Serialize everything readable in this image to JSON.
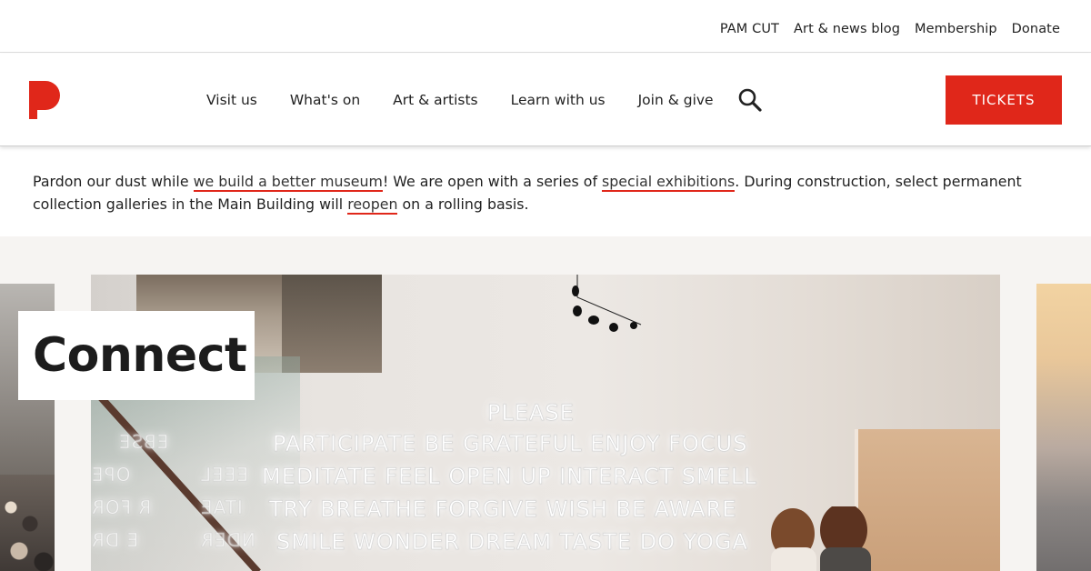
{
  "utility_nav": {
    "items": [
      "PAM CUT",
      "Art & news blog",
      "Membership",
      "Donate"
    ]
  },
  "header": {
    "logo_letter": "P",
    "nav_items": [
      "Visit us",
      "What's on",
      "Art & artists",
      "Learn with us",
      "Join & give"
    ],
    "search_icon": "search-icon",
    "tickets_label": "TICKETS"
  },
  "notice": {
    "part1": "Pardon our dust while ",
    "link1": "we build a better museum",
    "part2": "! We are open with a series of ",
    "link2": "special exhibitions",
    "part3": ". During construction, select permanent collection galleries in the Main Building will ",
    "link3": "reopen",
    "part4": " on a rolling basis."
  },
  "carousel": {
    "headline": "Connect",
    "neon_lines": [
      "PLEASE",
      "PARTICIPATE   BE GRATEFUL   ENJOY   FOCUS",
      "MEDITATE   FEEL   OPEN UP   INTERACT   SMELL",
      "TRY   BREATHE   FORGIVE   WISH   BE AWARE",
      "SMILE   WONDER   DREAM   TASTE   DO YOGA"
    ],
    "neon_mirrored": [
      "EBSE",
      "EEEL",
      "OPE",
      "R FOR",
      "E DR",
      "ITAE",
      "NDER",
      "ANTI"
    ]
  },
  "colors": {
    "brand_red": "#e0271a",
    "background": "#ffffff",
    "carousel_bg": "#f6f4f2"
  }
}
